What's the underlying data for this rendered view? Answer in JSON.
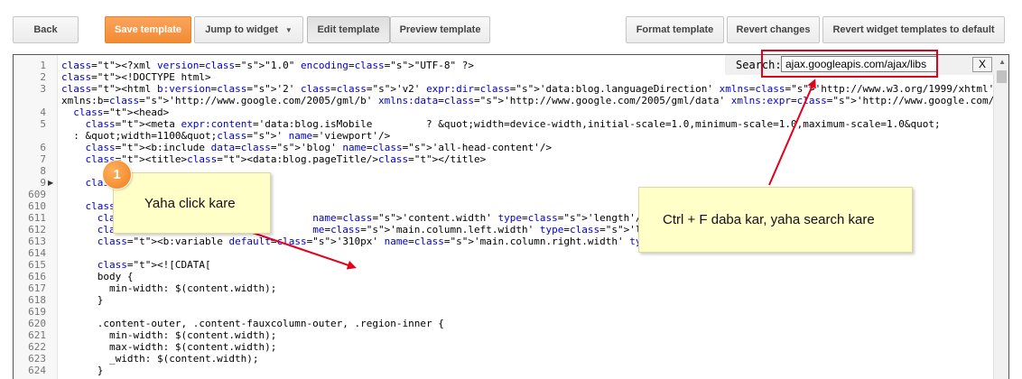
{
  "toolbar": {
    "back": "Back",
    "save_template": "Save template",
    "jump_to_widget": "Jump to widget",
    "edit_template": "Edit template",
    "preview_template": "Preview template",
    "format_template": "Format template",
    "revert_changes": "Revert changes",
    "revert_widget_templates": "Revert widget templates to default"
  },
  "search": {
    "label": "Search:",
    "value": "ajax.googleapis.com/ajax/libs",
    "close": "X"
  },
  "annotations": {
    "marker_number": "1",
    "click_note": "Yaha click kare",
    "search_note": "Ctrl + F daba kar, yaha search kare"
  },
  "lines": [
    {
      "num": "1",
      "code": "<?xml version=\"1.0\" encoding=\"UTF-8\" ?>"
    },
    {
      "num": "2",
      "code": "<!DOCTYPE html>"
    },
    {
      "num": "3",
      "code": "<html b:version='2' class='v2' expr:dir='data:blog.languageDirection' xmlns='http://www.w3.org/1999/xhtml'"
    },
    {
      "num": "",
      "code": "xmlns:b='http://www.google.com/2005/gml/b' xmlns:data='http://www.google.com/2005/gml/data' xmlns:expr='http://www.google.com/2005/gml/expr'>"
    },
    {
      "num": "4",
      "code": "  <head>"
    },
    {
      "num": "5",
      "code": "    <meta expr:content='data:blog.isMobile         ? &quot;width=device-width,initial-scale=1.0,minimum-scale=1.0,maximum-scale=1.0&quot;"
    },
    {
      "num": "",
      "code": "  : &quot;width=1100&quot;' name='viewport'/>"
    },
    {
      "num": "6",
      "code": "    <b:include data='blog' name='all-head-content'/>"
    },
    {
      "num": "7",
      "code": "    <title><data:blog.pageTitle/></title>"
    },
    {
      "num": "8",
      "code": ""
    },
    {
      "num": "9",
      "code": "    <b:s"
    },
    {
      "num": "609",
      "code": ""
    },
    {
      "num": "610",
      "code": "    <b:te"
    },
    {
      "num": "611",
      "code": "      <b                        name='content.width' type='length'/>"
    },
    {
      "num": "612",
      "code": "      <b                        me='main.column.left.width' type='length'/>"
    },
    {
      "num": "613",
      "code": "      <b:variable default='310px' name='main.column.right.width' type='length'/>"
    },
    {
      "num": "614",
      "code": ""
    },
    {
      "num": "615",
      "code": "      <![CDATA["
    },
    {
      "num": "616",
      "code": "      body {"
    },
    {
      "num": "617",
      "code": "        min-width: $(content.width);"
    },
    {
      "num": "618",
      "code": "      }"
    },
    {
      "num": "619",
      "code": ""
    },
    {
      "num": "620",
      "code": "      .content-outer, .content-fauxcolumn-outer, .region-inner {"
    },
    {
      "num": "621",
      "code": "        min-width: $(content.width);"
    },
    {
      "num": "622",
      "code": "        max-width: $(content.width);"
    },
    {
      "num": "623",
      "code": "        _width: $(content.width);"
    },
    {
      "num": "624",
      "code": "      }"
    }
  ]
}
